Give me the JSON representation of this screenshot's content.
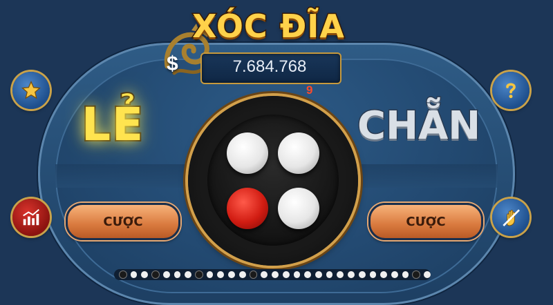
{
  "game": {
    "title": "XÓC ĐĨA"
  },
  "balance": {
    "currency_symbol": "$",
    "value": "7.684.768"
  },
  "timer": {
    "seconds": "9"
  },
  "sides": {
    "left_label": "LẺ",
    "right_label": "CHẴN"
  },
  "buttons": {
    "bet_left": "CƯỢC",
    "bet_right": "CƯỢC",
    "favorites_icon": "star-icon",
    "help_icon": "question-icon",
    "stats_icon": "bar-chart-icon",
    "mute_icon": "hand-muted-icon"
  },
  "bowl": {
    "coins": [
      "white",
      "white",
      "red",
      "white"
    ]
  },
  "history": {
    "results": [
      "black",
      "white",
      "white",
      "black",
      "white",
      "white",
      "white",
      "black",
      "white",
      "white",
      "white",
      "white",
      "black",
      "white",
      "white",
      "white",
      "white",
      "white",
      "white",
      "white",
      "white",
      "white",
      "white",
      "white",
      "white",
      "white",
      "white",
      "black",
      "white"
    ]
  },
  "colors": {
    "title_gold": "#ffd24a",
    "le_yellow": "#ffe44f",
    "chan_silver": "#d9dfe6",
    "bet_orange": "#d97a3e",
    "timer_red": "#ff4a2a",
    "table_blue": "#234a72"
  }
}
